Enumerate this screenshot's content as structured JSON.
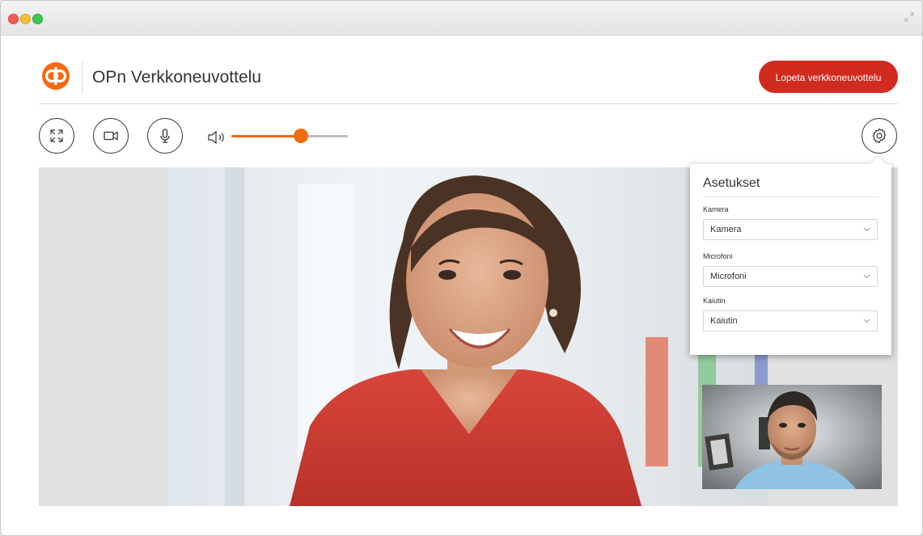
{
  "header": {
    "title": "OPn Verkkoneuvottelu",
    "end_button_label": "Lopeta verkkoneuvottelu",
    "logo_icon": "op-logo-icon"
  },
  "controls": {
    "fullscreen_icon": "expand-icon",
    "camera_icon": "camera-icon",
    "microphone_icon": "microphone-icon",
    "volume_icon": "speaker-icon",
    "settings_icon": "gear-icon",
    "volume_level": 0.6
  },
  "settings": {
    "title": "Asetukset",
    "camera": {
      "label": "Kamera",
      "value": "Kamera"
    },
    "microphone": {
      "label": "Microfoni",
      "value": "Microfoni"
    },
    "speaker": {
      "label": "Kaiutin",
      "value": "Kaiutin"
    }
  },
  "colors": {
    "brand": "#f26b0f",
    "end_button": "#d12b1f"
  }
}
